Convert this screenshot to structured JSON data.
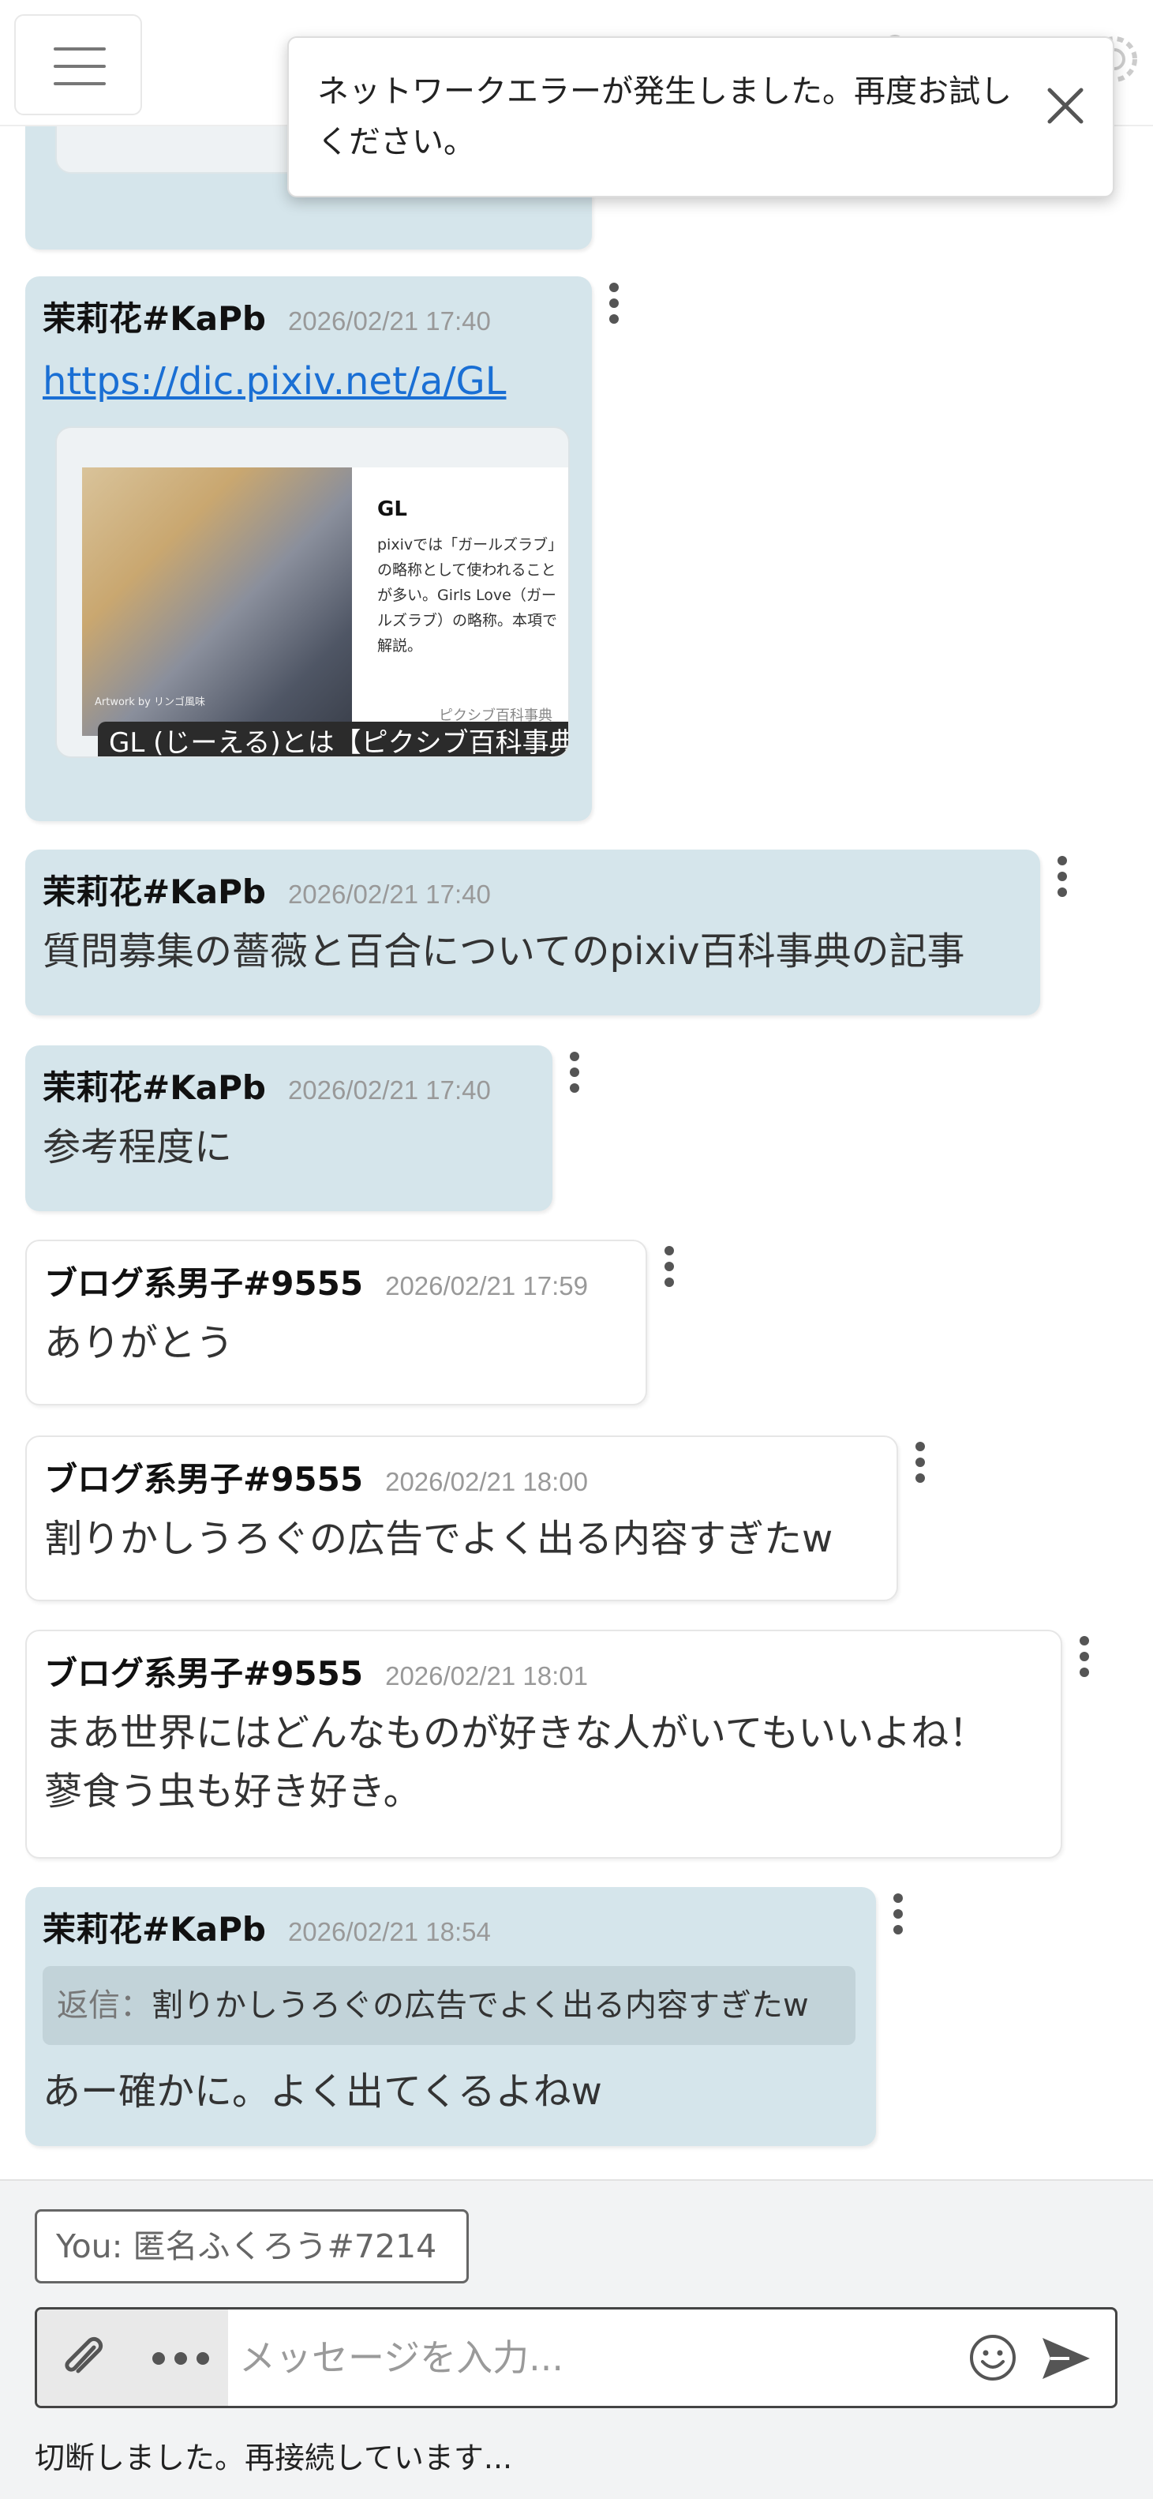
{
  "toast": {
    "message": "ネットワークエラーが発生しました。再度お試しください。"
  },
  "messages": [
    {
      "author": "茉莉花#KaPb",
      "time": "2026/02/21 17:40",
      "link": "https://dic.pixiv.net/a/GL",
      "preview": {
        "title": "GL",
        "description": "pixivでは「ガールズラブ」の略称として使われることが多い。Girls Love（ガールズラブ）の略称。本項で解説。",
        "source": "ピクシブ百科事典",
        "artwork_credit": "Artwork by リンゴ風味",
        "caption": "GL (じーえる)とは【ピクシブ百科事典】"
      }
    },
    {
      "author": "茉莉花#KaPb",
      "time": "2026/02/21 17:40",
      "text": "質問募集の薔薇と百合についてのpixiv百科事典の記事"
    },
    {
      "author": "茉莉花#KaPb",
      "time": "2026/02/21 17:40",
      "text": "参考程度に"
    },
    {
      "author": "ブログ系男子#9555",
      "time": "2026/02/21 17:59",
      "text": "ありがとう"
    },
    {
      "author": "ブログ系男子#9555",
      "time": "2026/02/21 18:00",
      "text": "割りかしうろぐの広告でよく出る内容すぎたw"
    },
    {
      "author": "ブログ系男子#9555",
      "time": "2026/02/21 18:01",
      "text_line1": "まあ世界にはどんなものが好きな人がいてもいいよね！",
      "text_line2": "蓼食う虫も好き好き。"
    },
    {
      "author": "茉莉花#KaPb",
      "time": "2026/02/21 18:54",
      "reply_label": "返信：",
      "reply_text": "割りかしうろぐの広告でよく出る内容すぎたw",
      "text": "あー確かに。よく出てくるよねw"
    }
  ],
  "footer": {
    "you_label": "You: 匿名ふくろう#7214",
    "input_placeholder": "メッセージを入力...",
    "status": "切断しました。再接続しています..."
  },
  "colors": {
    "self_bubble": "#d5e5eb",
    "other_bubble": "#ffffff",
    "link": "#1a6fd4"
  }
}
